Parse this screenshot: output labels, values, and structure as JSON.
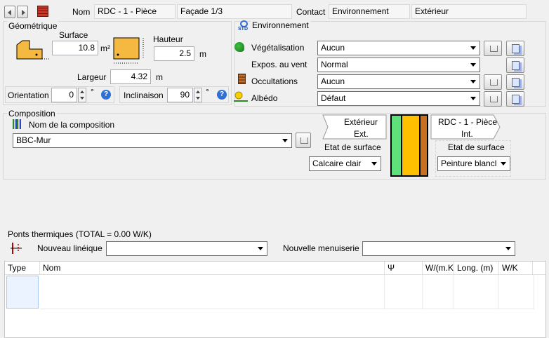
{
  "header": {
    "nom_label": "Nom",
    "nom_value": "RDC - 1 - Pièce",
    "facade_value": "Façade 1/3",
    "contact_label": "Contact",
    "contact_value": "Environnement",
    "contact_side": "Extérieur"
  },
  "geometrie": {
    "title": "Géométrique",
    "surface_label": "Surface",
    "surface_value": "10.8",
    "surface_unit": "m²",
    "hauteur_label": "Hauteur",
    "hauteur_value": "2.5",
    "hauteur_unit": "m",
    "largeur_label": "Largeur",
    "largeur_value": "4.32",
    "largeur_unit": "m",
    "orientation_label": "Orientation",
    "orientation_value": "0",
    "orientation_unit": "°",
    "inclinaison_label": "Inclinaison",
    "inclinaison_value": "90",
    "inclinaison_unit": "°",
    "help_glyph": "?"
  },
  "environnement": {
    "title": "Environnement",
    "std_badge": "STD",
    "rows": [
      {
        "label": "Végétalisation",
        "value": "Aucun"
      },
      {
        "label": "Expos. au vent",
        "value": "Normal"
      },
      {
        "label": "Occultations",
        "value": "Aucun"
      },
      {
        "label": "Albédo",
        "value": "Défaut"
      }
    ]
  },
  "composition": {
    "title": "Composition",
    "name_label": "Nom de la composition",
    "name_value": "BBC-Mur",
    "ext_title": "Extérieur",
    "ext_short": "Ext.",
    "int_title": "RDC - 1 - Pièce",
    "int_short": "Int.",
    "etat_surface_label": "Etat de surface",
    "ext_surface_value": "Calcaire clair",
    "int_surface_value": "Peinture blancl",
    "layer_colors": {
      "outer": "#5fe07a",
      "core": "#ffc000",
      "inner": "#c87020",
      "frame": "#000000"
    }
  },
  "ponts": {
    "title": "Ponts thermiques (TOTAL = 0.00 W/K)",
    "lineique_label": "Nouveau linéique",
    "menuiserie_label": "Nouvelle menuiserie",
    "columns": [
      "Type",
      "Nom",
      "Ψ",
      "W/(m.K",
      "Long. (m)",
      "W/K"
    ]
  }
}
